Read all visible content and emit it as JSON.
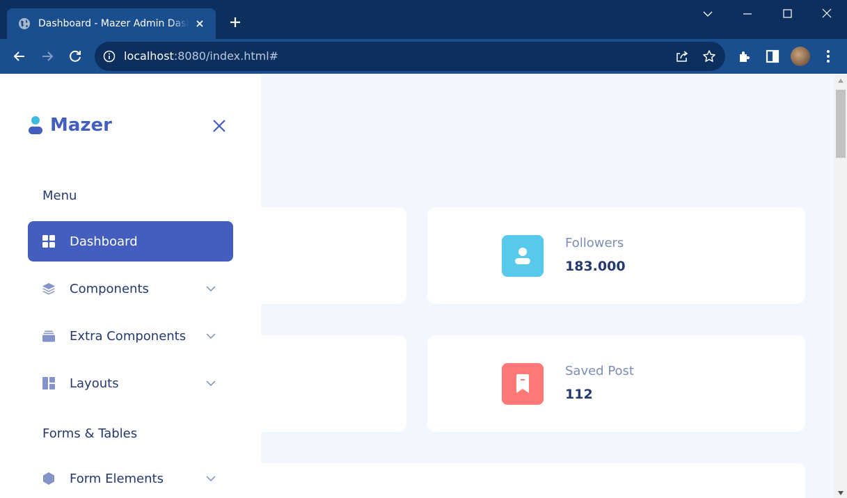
{
  "browser": {
    "tab_title": "Dashboard - Mazer Admin Dashboard",
    "url_host": "localhost",
    "url_rest": ":8080/index.html#"
  },
  "sidebar": {
    "brand": "Mazer",
    "sections": [
      {
        "title": "Menu"
      },
      {
        "title": "Forms & Tables"
      }
    ],
    "items": [
      {
        "label": "Dashboard",
        "icon": "grid-icon",
        "active": true
      },
      {
        "label": "Components",
        "icon": "stack-icon"
      },
      {
        "label": "Extra Components",
        "icon": "collection-icon"
      },
      {
        "label": "Layouts",
        "icon": "layout-icon"
      },
      {
        "label": "Form Elements",
        "icon": "hexagon-icon"
      }
    ]
  },
  "stats": [
    {
      "label": "Followers",
      "value": "183.000",
      "icon": "person-icon",
      "color": "#57caeb"
    },
    {
      "label": "Saved Post",
      "value": "112",
      "icon": "bookmark-icon",
      "color": "#ff7976"
    }
  ],
  "colors": {
    "primary": "#435ebe",
    "text": "#25396f",
    "page_bg": "#f2f7ff"
  }
}
